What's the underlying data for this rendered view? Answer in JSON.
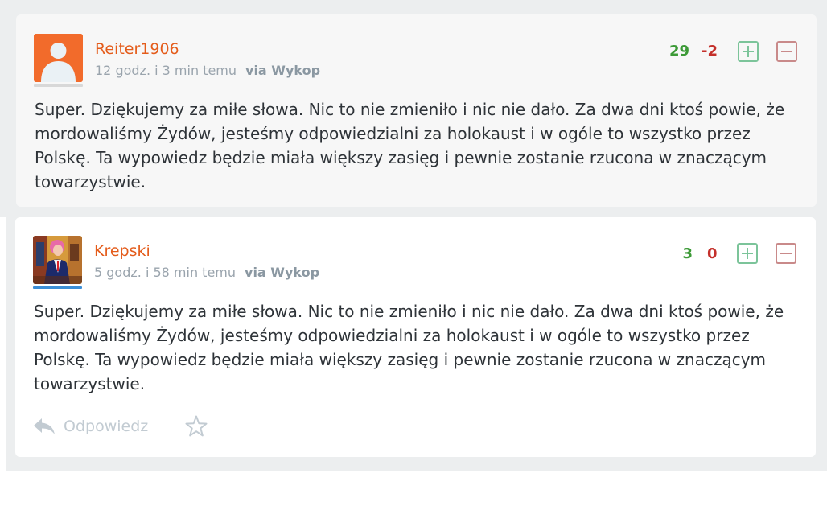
{
  "comments": [
    {
      "username": "Reiter1906",
      "time": "12 godz. i 3 min temu",
      "via": "via Wykop",
      "plus_count": "29",
      "minus_count": "-2",
      "text": "Super. Dziękujemy za miłe słowa. Nic to nie zmieniło i nic nie dało. Za dwa dni ktoś powie, że mordowaliśmy Żydów, jesteśmy odpowiedzialni za holokaust i w ogóle to wszystko przez Polskę. Ta wypowiedz będzie miała większy zasięg i pewnie zostanie rzucona w znaczącym towarzystwie.",
      "avatar_color": "#f26b2b"
    },
    {
      "username": "Krepski",
      "time": "5 godz. i 58 min temu",
      "via": "via Wykop",
      "plus_count": "3",
      "minus_count": "0",
      "text": "Super. Dziękujemy za miłe słowa. Nic to nie zmieniło i nic nie dało. Za dwa dni ktoś powie, że mordowaliśmy Żydów, jesteśmy odpowiedzialni za holokaust i w ogóle to wszystko przez Polskę. Ta wypowiedz będzie miała większy zasięg i pewnie zostanie rzucona w znaczącym towarzystwie.",
      "reply_label": "Odpowiedz"
    }
  ],
  "colors": {
    "username": "#e45c1b",
    "plus": "#3c9a37",
    "minus": "#c4302b",
    "vote_up_border": "#7cc49a",
    "vote_down_border": "#c98a8a"
  },
  "icons": [
    "default-avatar-icon",
    "user-avatar-image",
    "plus-vote-icon",
    "minus-vote-icon",
    "reply-icon",
    "star-icon"
  ]
}
